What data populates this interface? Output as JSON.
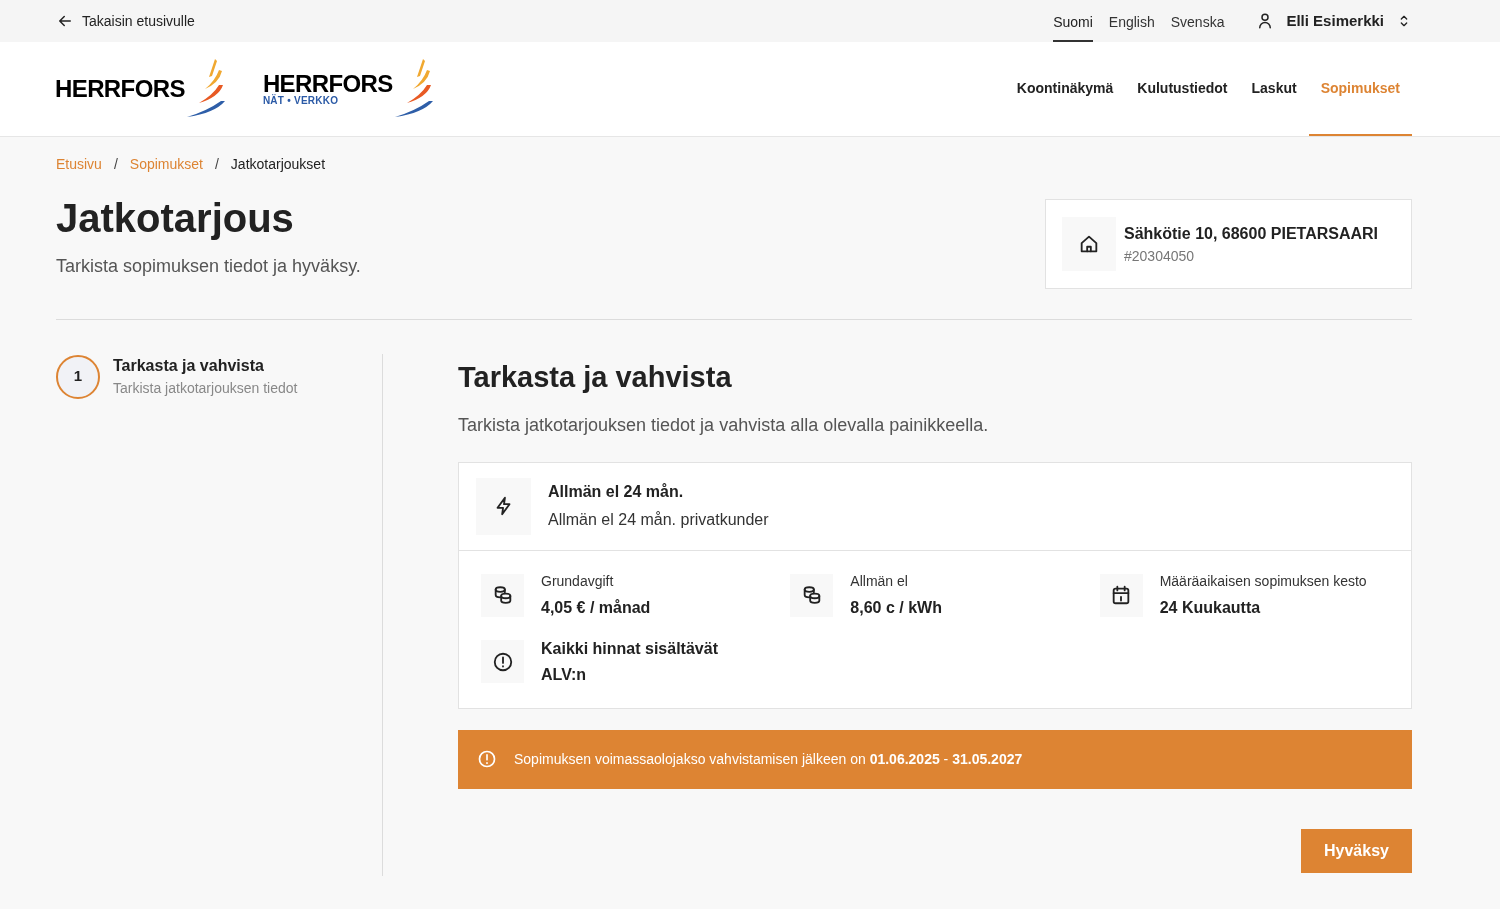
{
  "top_bar": {
    "back_link": "Takaisin etusivulle",
    "languages": [
      {
        "label": "Suomi",
        "selected": true
      },
      {
        "label": "English",
        "selected": false
      },
      {
        "label": "Svenska",
        "selected": false
      }
    ],
    "user": "Elli Esimerkki"
  },
  "logos": [
    {
      "name": "HERRFORS"
    },
    {
      "name": "HERRFORS",
      "tagline": "NÄT • VERKKO"
    }
  ],
  "nav": [
    {
      "label": "Koontinäkymä",
      "selected": false
    },
    {
      "label": "Kulutustiedot",
      "selected": false
    },
    {
      "label": "Laskut",
      "selected": false
    },
    {
      "label": "Sopimukset",
      "selected": true
    }
  ],
  "breadcrumbs": [
    {
      "kind": "link",
      "label": "Etusivu"
    },
    {
      "kind": "separator",
      "label": "/"
    },
    {
      "kind": "link",
      "label": "Sopimukset"
    },
    {
      "kind": "separator",
      "label": "/"
    },
    {
      "kind": "current",
      "label": "Jatkotarjoukset"
    }
  ],
  "title": "Jatkotarjous",
  "subtitle": "Tarkista sopimuksen tiedot ja hyväksy.",
  "address_card": {
    "address": "Sähkötie 10, 68600 PIETARSAARI",
    "id": "#20304050"
  },
  "steps": [
    {
      "number": "1",
      "title": "Tarkasta ja vahvista",
      "description": "Tarkista jatkotarjouksen tiedot",
      "selected": true
    }
  ],
  "section": {
    "title": "Tarkasta ja vahvista",
    "intro": "Tarkista jatkotarjouksen tiedot ja vahvista alla olevalla painikkeella.",
    "product": {
      "name": "Allmän el 24 mån.",
      "description": "Allmän el 24 mån. privatkunder"
    },
    "details": [
      {
        "kind": "price",
        "label": "Grundavgift",
        "value": "4,05 € / månad"
      },
      {
        "kind": "price",
        "label": "Allmän el",
        "value": "8,60 c / kWh"
      },
      {
        "kind": "calendar",
        "label": "Määräaikaisen sopimuksen kesto",
        "value": "24 Kuukautta"
      },
      {
        "kind": "info",
        "value": "Kaikki hinnat sisältävät ALV:n"
      }
    ],
    "notice": "Sopimuksen voimassaolojakso vahvistamisen jälkeen on **01.06.2025** - **31.05.2027**",
    "button": "Hyväksy"
  }
}
